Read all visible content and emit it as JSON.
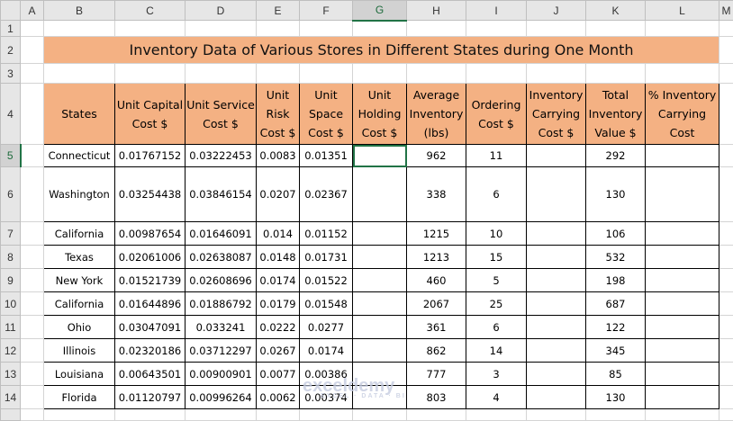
{
  "columns": [
    "A",
    "B",
    "C",
    "D",
    "E",
    "F",
    "G",
    "H",
    "I",
    "J",
    "K",
    "L",
    "M"
  ],
  "row_numbers": [
    "1",
    "2",
    "3",
    "4",
    "5",
    "6",
    "7",
    "8",
    "9",
    "10",
    "11",
    "12",
    "13",
    "14",
    ""
  ],
  "selected_cell": "G5",
  "title": "Inventory Data of Various Stores in Different States during One Month",
  "headers": [
    "States",
    "Unit Capital Cost $",
    "Unit Service Cost $",
    "Unit Risk Cost $",
    "Unit Space Cost $",
    "Unit Holding Cost $",
    "Average Inventory (lbs)",
    "Ordering Cost $",
    "Inventory Carrying Cost $",
    "Total Inventory Value $",
    "% Inventory Carrying Cost"
  ],
  "rows": [
    [
      "Connecticut",
      "0.01767152",
      "0.03222453",
      "0.0083",
      "0.01351",
      "",
      "962",
      "11",
      "",
      "292",
      ""
    ],
    [
      "Washington",
      "0.03254438",
      "0.03846154",
      "0.0207",
      "0.02367",
      "",
      "338",
      "6",
      "",
      "130",
      ""
    ],
    [
      "California",
      "0.00987654",
      "0.01646091",
      "0.014",
      "0.01152",
      "",
      "1215",
      "10",
      "",
      "106",
      ""
    ],
    [
      "Texas",
      "0.02061006",
      "0.02638087",
      "0.0148",
      "0.01731",
      "",
      "1213",
      "15",
      "",
      "532",
      ""
    ],
    [
      "New York",
      "0.01521739",
      "0.02608696",
      "0.0174",
      "0.01522",
      "",
      "460",
      "5",
      "",
      "198",
      ""
    ],
    [
      "California",
      "0.01644896",
      "0.01886792",
      "0.0179",
      "0.01548",
      "",
      "2067",
      "25",
      "",
      "687",
      ""
    ],
    [
      "Ohio",
      "0.03047091",
      "0.033241",
      "0.0222",
      "0.0277",
      "",
      "361",
      "6",
      "",
      "122",
      ""
    ],
    [
      "Illinois",
      "0.02320186",
      "0.03712297",
      "0.0267",
      "0.0174",
      "",
      "862",
      "14",
      "",
      "345",
      ""
    ],
    [
      "Louisiana",
      "0.00643501",
      "0.00900901",
      "0.0077",
      "0.00386",
      "",
      "777",
      "3",
      "",
      "85",
      ""
    ],
    [
      "Florida",
      "0.01120797",
      "0.00996264",
      "0.0062",
      "0.00374",
      "",
      "803",
      "4",
      "",
      "130",
      ""
    ]
  ],
  "watermark": {
    "brand": "exceldemy",
    "tagline": "EXCEL · DATA · BI"
  },
  "colors": {
    "header_fill": "#f4b183",
    "selection": "#217346"
  }
}
